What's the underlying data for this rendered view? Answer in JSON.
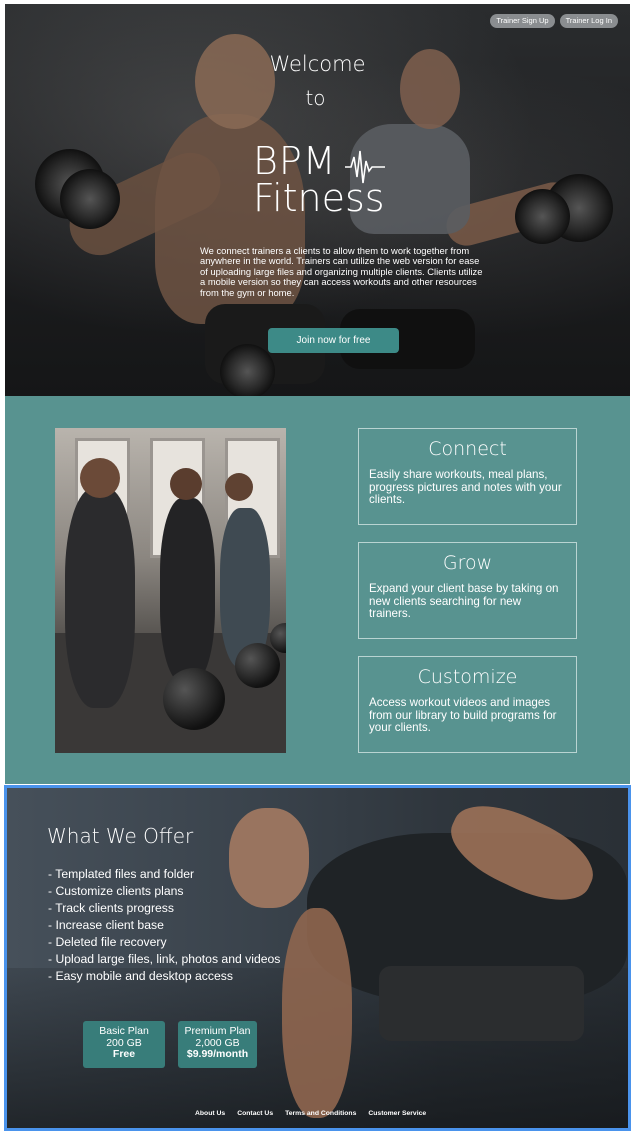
{
  "header": {
    "trainer_signup": "Trainer Sign Up",
    "trainer_login": "Trainer Log In"
  },
  "hero": {
    "welcome_line1": "Welcome",
    "welcome_line2": "to",
    "logo_line1": "BPM",
    "logo_line2": "Fitness",
    "intro": "We connect trainers a clients to allow them to work together from anywhere in the world. Trainers can utilize the web version for ease of uploading large files and organizing multiple clients. Clients utilize a mobile version so they can access workouts and other resources from the gym or home.",
    "cta": "Join now for free"
  },
  "features": [
    {
      "title": "Connect",
      "text": "Easily share workouts, meal plans, progress pictures and notes with your clients."
    },
    {
      "title": "Grow",
      "text": "Expand your client base by taking on new clients searching for new trainers."
    },
    {
      "title": "Customize",
      "text": "Access workout videos and images from our library to build programs for your clients."
    }
  ],
  "offer": {
    "title": "What We Offer",
    "items": [
      "- Templated files and folder",
      "- Customize clients plans",
      "- Track clients progress",
      "- Increase client base",
      "- Deleted file recovery",
      "- Upload large files, link, photos and videos",
      "- Easy mobile and desktop access"
    ],
    "plans": [
      {
        "name": "Basic Plan",
        "storage": "200 GB",
        "price": "Free"
      },
      {
        "name": "Premium Plan",
        "storage": "2,000 GB",
        "price": "$9.99/month"
      }
    ]
  },
  "footer": {
    "links": [
      "About Us",
      "Contact Us",
      "Terms and Conditions",
      "Customer Service"
    ]
  },
  "colors": {
    "teal_section": "#589390",
    "button_teal": "#3d8a87",
    "plan_teal": "#387d7a",
    "selection_border": "#4a93ec"
  }
}
